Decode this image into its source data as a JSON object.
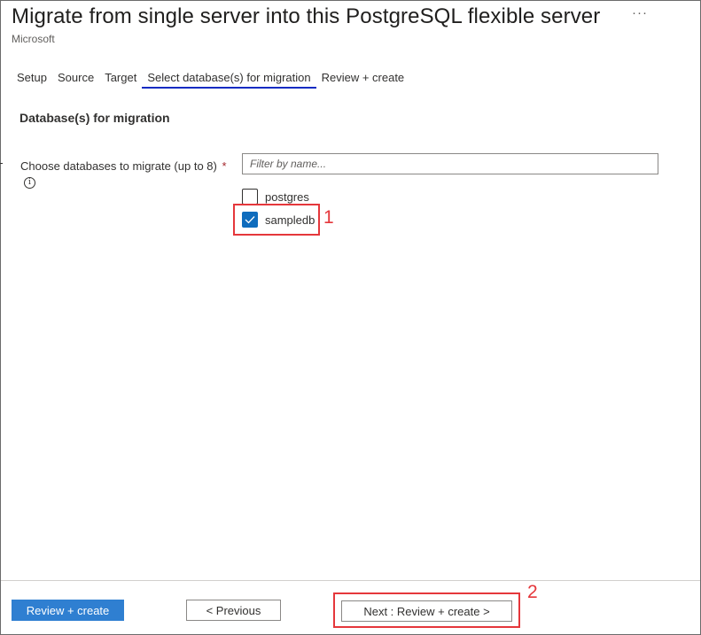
{
  "header": {
    "title": "Migrate from single server into this PostgreSQL flexible server",
    "subtitle": "Microsoft",
    "more_label": "···"
  },
  "tabs": [
    {
      "label": "Setup",
      "active": false
    },
    {
      "label": "Source",
      "active": false
    },
    {
      "label": "Target",
      "active": false
    },
    {
      "label": "Select database(s) for migration",
      "active": true
    },
    {
      "label": "Review + create",
      "active": false
    }
  ],
  "section": {
    "title": "Database(s) for migration",
    "field_label": "Choose databases to migrate (up to 8)",
    "required_mark": "*",
    "info_icon": "i",
    "filter_placeholder": "Filter by name...",
    "databases": [
      {
        "name": "postgres",
        "checked": false
      },
      {
        "name": "sampledb",
        "checked": true
      }
    ]
  },
  "annotations": {
    "step1": "1",
    "step2": "2",
    "color": "#e5373b"
  },
  "footer": {
    "review_create_label": "Review + create",
    "previous_label": "< Previous",
    "next_label": "Next : Review + create >"
  },
  "colors": {
    "primary": "#2f7fd1",
    "checked": "#0f6cbd",
    "active_tab_underline": "#0f2bc2"
  }
}
